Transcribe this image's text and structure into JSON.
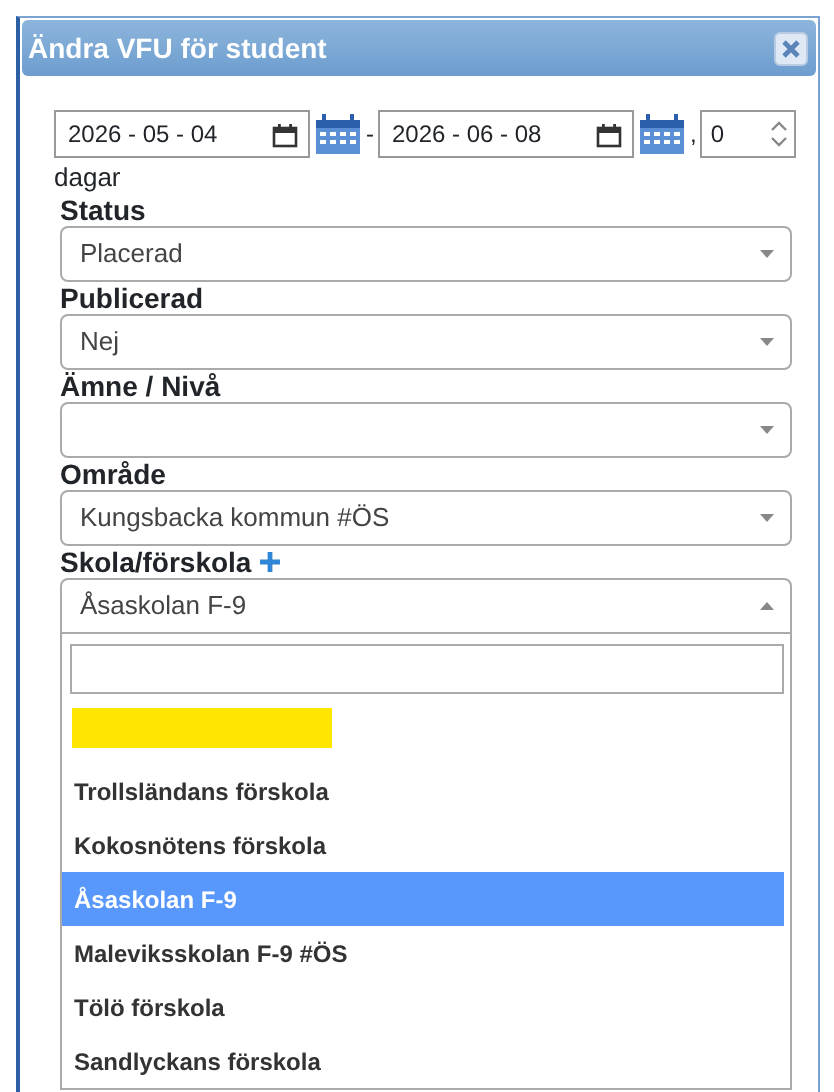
{
  "dialog": {
    "title": "Ändra VFU för student"
  },
  "period": {
    "start": "2026 - 05 - 04",
    "separator": "-",
    "end": "2026 - 06 - 08",
    "comma": ",",
    "days": "0",
    "unit": "dagar"
  },
  "fields": [
    {
      "label": "Status",
      "value": "Placerad",
      "open": false
    },
    {
      "label": "Publicerad",
      "value": "Nej",
      "open": false
    },
    {
      "label": "Ämne / Nivå",
      "open": false
    },
    {
      "label": "Område",
      "value": "Kungsbacka kommun #ÖS",
      "open": false
    },
    {
      "label": "Skola/förskola",
      "value": "Åsaskolan F-9",
      "open": true,
      "add": true
    }
  ],
  "dropdown": {
    "options": [
      {
        "kind": "marker",
        "color": "#ffe600",
        "selected": false
      },
      {
        "kind": "text",
        "label": "Trollsländans förskola",
        "selected": false
      },
      {
        "kind": "text",
        "label": "Kokosnötens förskola",
        "selected": false
      },
      {
        "kind": "text",
        "label": "Åsaskolan F-9",
        "selected": true
      },
      {
        "kind": "text",
        "label": "Maleviksskolan F-9 #ÖS",
        "selected": false
      },
      {
        "kind": "text",
        "label": "Tölö förskola",
        "selected": false
      },
      {
        "kind": "text",
        "label": "Sandlyckans förskola",
        "selected": false
      }
    ]
  }
}
